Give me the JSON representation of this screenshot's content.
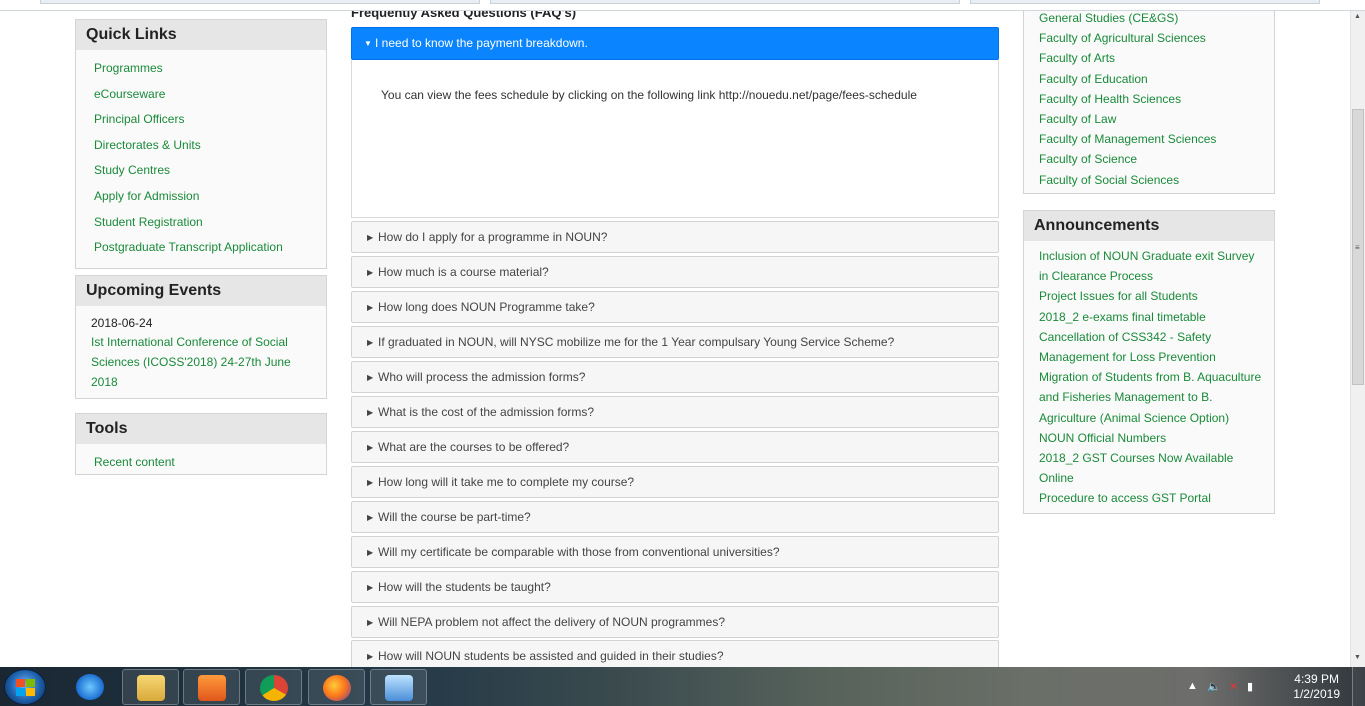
{
  "quick_links": {
    "title": "Quick Links",
    "items": [
      "Programmes",
      "eCourseware",
      "Principal Officers",
      "Directorates & Units",
      "Study Centres",
      "Apply for Admission",
      "Student Registration",
      "Postgraduate Transcript Application"
    ]
  },
  "upcoming_events": {
    "title": "Upcoming Events",
    "date": "2018-06-24",
    "event": "Ist International Conference of Social Sciences (ICOSS'2018) 24-27th June 2018"
  },
  "tools": {
    "title": "Tools",
    "items": [
      "Recent content"
    ]
  },
  "faq": {
    "title": "Frequently Asked Questions (FAQ's)",
    "active_question": "I need to know the payment breakdown.",
    "active_answer": "You can view the fees schedule by clicking on the following link http://nouedu.net/page/fees-schedule",
    "questions": [
      "How do I apply for a programme in NOUN?",
      "How much is a course material?",
      "How long does NOUN Programme take?",
      "If graduated in NOUN, will NYSC mobilize me for the 1 Year compulsary Young Service Scheme?",
      "Who will process the admission forms?",
      "What is the cost of the admission forms?",
      "What are the courses to be offered?",
      "How long will it take me to complete my course?",
      "Will the course be part-time?",
      "Will my certificate be comparable with those from conventional universities?",
      "How will the students be taught?",
      "Will NEPA problem not affect the delivery of NOUN programmes?",
      "How will NOUN students be assisted and guided in their studies?"
    ]
  },
  "faculties": {
    "items": [
      "General Studies (CE&GS)",
      "Faculty of Agricultural Sciences",
      "Faculty of Arts",
      "Faculty of Education",
      "Faculty of Health Sciences",
      "Faculty of Law",
      "Faculty of Management Sciences",
      "Faculty of Science",
      "Faculty of Social Sciences"
    ]
  },
  "announcements": {
    "title": "Announcements",
    "items": [
      "Inclusion of NOUN Graduate exit Survey in Clearance Process",
      "Project Issues for all Students",
      "2018_2 e-exams final timetable",
      "Cancellation of CSS342 - Safety Management for Loss Prevention",
      "Migration of Students from B. Aquaculture and Fisheries Management to B. Agriculture (Animal Science Option)",
      "NOUN Official Numbers",
      "2018_2 GST Courses Now Available Online",
      "Procedure to access GST Portal"
    ]
  },
  "taskbar": {
    "time": "4:39 PM",
    "date": "1/2/2019",
    "apps": [
      "start-button",
      "internet-explorer-icon",
      "file-explorer-icon",
      "media-player-icon",
      "chrome-icon",
      "firefox-icon",
      "remote-desktop-icon"
    ]
  },
  "colors": {
    "link_green": "#1a8a3a",
    "faq_active_blue": "#0a84ff",
    "block_header_gray": "#e6e6e6"
  }
}
